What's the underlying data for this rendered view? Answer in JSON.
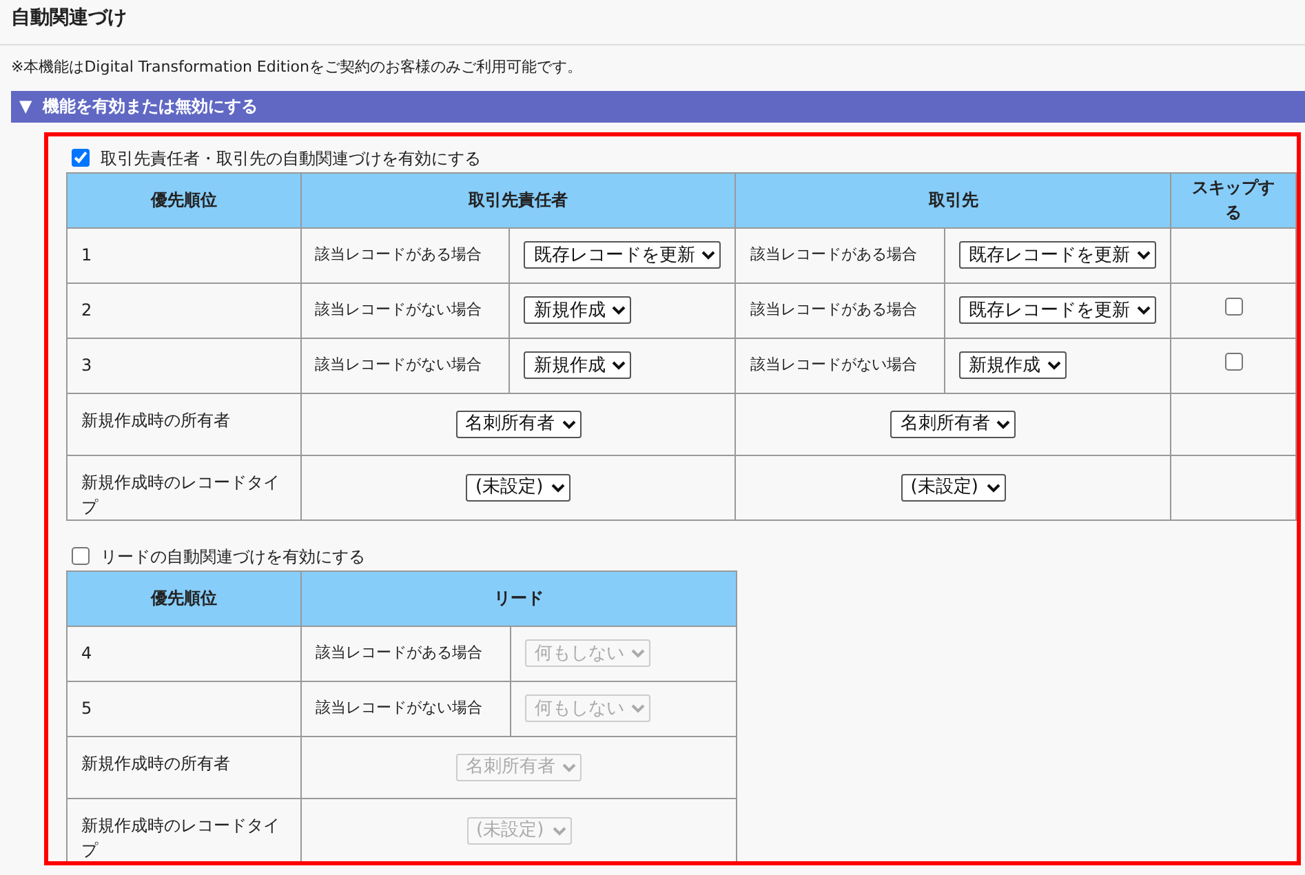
{
  "page_title": "自動関連づけ",
  "notice": "※本機能はDigital Transformation Editionをご契約のお客様のみご利用可能です。",
  "section": {
    "toggle": "▼",
    "title": "機能を有効または無効にする"
  },
  "groups": [
    {
      "enable_label": "取引先責任者・取引先の自動関連づけを有効にする",
      "checked": true,
      "columns": [
        "優先順位",
        "取引先責任者",
        "取引先",
        "スキップする"
      ],
      "rows": [
        {
          "kind": "priority",
          "label": "1",
          "targets": [
            {
              "condition": "該当レコードがある場合",
              "action": {
                "value": "既存レコードを更新",
                "disabled": false
              }
            },
            {
              "condition": "該当レコードがある場合",
              "action": {
                "value": "既存レコードを更新",
                "disabled": false
              }
            }
          ]
        },
        {
          "kind": "priority",
          "label": "2",
          "targets": [
            {
              "condition": "該当レコードがない場合",
              "action": {
                "value": "新規作成",
                "disabled": false
              }
            },
            {
              "condition": "該当レコードがある場合",
              "action": {
                "value": "既存レコードを更新",
                "disabled": false
              }
            }
          ],
          "skip": {
            "checked": false
          }
        },
        {
          "kind": "priority",
          "label": "3",
          "targets": [
            {
              "condition": "該当レコードがない場合",
              "action": {
                "value": "新規作成",
                "disabled": false
              }
            },
            {
              "condition": "該当レコードがない場合",
              "action": {
                "value": "新規作成",
                "disabled": false
              }
            }
          ],
          "skip": {
            "checked": false
          }
        },
        {
          "kind": "setting",
          "label": "新規作成時の所有者",
          "targets": [
            {
              "action": {
                "value": "名刺所有者",
                "disabled": false
              }
            },
            {
              "action": {
                "value": "名刺所有者",
                "disabled": false
              }
            }
          ]
        },
        {
          "kind": "setting",
          "label": "新規作成時のレコードタイプ",
          "targets": [
            {
              "action": {
                "value": "(未設定)",
                "disabled": false
              }
            },
            {
              "action": {
                "value": "(未設定)",
                "disabled": false
              }
            }
          ]
        }
      ]
    },
    {
      "enable_label": "リードの自動関連づけを有効にする",
      "checked": false,
      "columns": [
        "優先順位",
        "リード"
      ],
      "rows": [
        {
          "kind": "priority",
          "label": "4",
          "targets": [
            {
              "condition": "該当レコードがある場合",
              "action": {
                "value": "何もしない",
                "disabled": true
              }
            }
          ]
        },
        {
          "kind": "priority",
          "label": "5",
          "targets": [
            {
              "condition": "該当レコードがない場合",
              "action": {
                "value": "何もしない",
                "disabled": true
              }
            }
          ]
        },
        {
          "kind": "setting",
          "label": "新規作成時の所有者",
          "targets": [
            {
              "action": {
                "value": "名刺所有者",
                "disabled": true
              }
            }
          ]
        },
        {
          "kind": "setting",
          "label": "新規作成時のレコードタイプ",
          "targets": [
            {
              "action": {
                "value": "(未設定)",
                "disabled": true
              }
            }
          ]
        }
      ]
    }
  ]
}
